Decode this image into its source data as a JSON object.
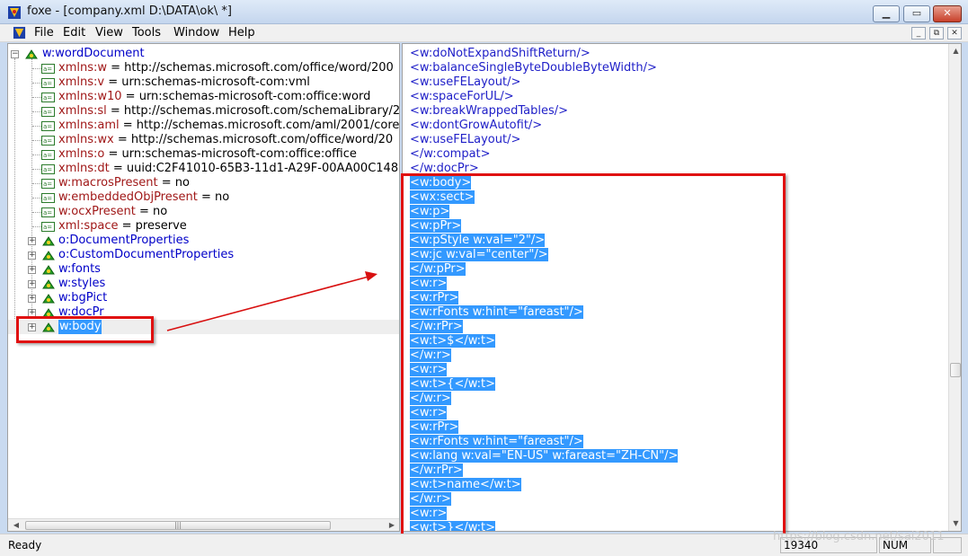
{
  "window": {
    "title": "foxe - [company.xml  D:\\DATA\\ok\\ *]",
    "minimize_glyph": "▁",
    "maximize_glyph": "▭",
    "close_glyph": "✕"
  },
  "menubar": {
    "items": [
      "File",
      "Edit",
      "View",
      "Tools",
      "Window",
      "Help"
    ],
    "mdi_controls": [
      "_",
      "⧉",
      "✕"
    ]
  },
  "tree": {
    "root": "w:wordDocument",
    "attributes": [
      {
        "name": "xmlns:w",
        "value": " = http://schemas.microsoft.com/office/word/200"
      },
      {
        "name": "xmlns:v",
        "value": " = urn:schemas-microsoft-com:vml"
      },
      {
        "name": "xmlns:w10",
        "value": " = urn:schemas-microsoft-com:office:word"
      },
      {
        "name": "xmlns:sl",
        "value": " = http://schemas.microsoft.com/schemaLibrary/2"
      },
      {
        "name": "xmlns:aml",
        "value": " = http://schemas.microsoft.com/aml/2001/core"
      },
      {
        "name": "xmlns:wx",
        "value": " = http://schemas.microsoft.com/office/word/20"
      },
      {
        "name": "xmlns:o",
        "value": " = urn:schemas-microsoft-com:office:office"
      },
      {
        "name": "xmlns:dt",
        "value": " = uuid:C2F41010-65B3-11d1-A29F-00AA00C148"
      },
      {
        "name": "w:macrosPresent",
        "value": " = no"
      },
      {
        "name": "w:embeddedObjPresent",
        "value": " = no"
      },
      {
        "name": "w:ocxPresent",
        "value": " = no"
      },
      {
        "name": "xml:space",
        "value": " = preserve"
      }
    ],
    "children": [
      "o:DocumentProperties",
      "o:CustomDocumentProperties",
      "w:fonts",
      "w:styles",
      "w:bgPict",
      "w:docPr",
      "w:body"
    ],
    "selected": "w:body",
    "hscroll_thumb": "|||"
  },
  "source": {
    "lines": [
      "<w:doNotExpandShiftReturn/>",
      "<w:balanceSingleByteDoubleByteWidth/>",
      "<w:useFELayout/>",
      "<w:spaceForUL/>",
      "<w:breakWrappedTables/>",
      "<w:dontGrowAutofit/>",
      "<w:useFELayout/>",
      "</w:compat>",
      "</w:docPr>",
      "<w:body>",
      "<wx:sect>",
      "<w:p>",
      "<w:pPr>",
      "<w:pStyle w:val=\"2\"/>",
      "<w:jc w:val=\"center\"/>",
      "</w:pPr>",
      "<w:r>",
      "<w:rPr>",
      "<w:rFonts w:hint=\"fareast\"/>",
      "</w:rPr>",
      "<w:t>$</w:t>",
      "</w:r>",
      "<w:r>",
      "<w:t>{</w:t>",
      "</w:r>",
      "<w:r>",
      "<w:rPr>",
      "<w:rFonts w:hint=\"fareast\"/>",
      "<w:lang w:val=\"EN-US\" w:fareast=\"ZH-CN\"/>",
      "</w:rPr>",
      "<w:t>name</w:t>",
      "</w:r>",
      "<w:r>",
      "<w:t>}</w:t>"
    ],
    "highlight_from_index": 9
  },
  "status": {
    "ready": "Ready",
    "position": "19340",
    "num": "NUM"
  },
  "watermark": "https://blog.csdn.net/sai2011",
  "colors": {
    "annotation_red": "#e01010",
    "selection_blue": "#3399ff",
    "element_blue": "#0000c8",
    "attribute_red": "#a01818"
  }
}
